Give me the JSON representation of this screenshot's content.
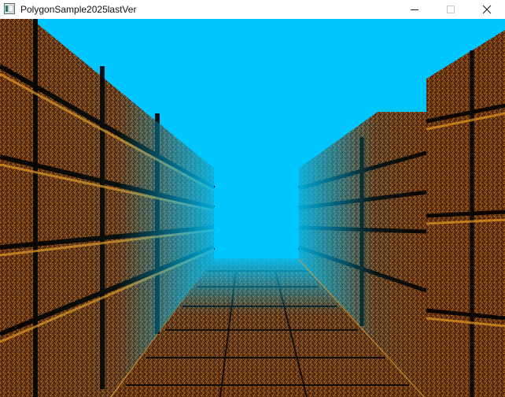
{
  "window": {
    "title": "PolygonSample2025lastVer"
  },
  "controls": {
    "minimize_icon": "minimize-icon",
    "maximize_icon": "maximize-icon",
    "close_icon": "close-icon"
  },
  "scene": {
    "sky_color": "#00c6ff",
    "brick_color": "#7a3e12",
    "brick_light": "#d8941e",
    "mortar_color": "#000000"
  }
}
